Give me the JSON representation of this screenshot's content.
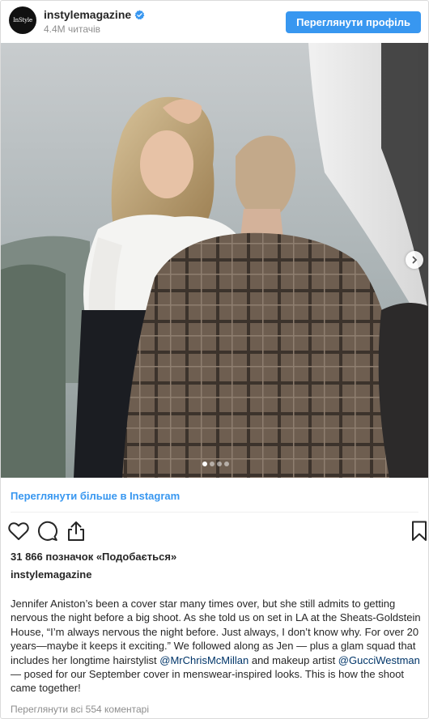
{
  "header": {
    "avatar_text": "InStyle",
    "username": "instylemagazine",
    "followers": "4.4M читачів",
    "profile_button": "Переглянути профіль",
    "verified_icon": "verified-badge-icon",
    "accent_color": "#3897f0"
  },
  "media": {
    "carousel_total": 4,
    "carousel_active": 1,
    "next_icon": "chevron-right-icon"
  },
  "view_more": "Переглянути більше в Instagram",
  "actions": {
    "like_icon": "heart-icon",
    "comment_icon": "comment-icon",
    "share_icon": "share-icon",
    "save_icon": "bookmark-icon"
  },
  "likes": "31 866 позначок «Подобається»",
  "caption": {
    "username": "instylemagazine",
    "text_1": "Jennifer Aniston’s been a cover star many times over, but she still admits to getting nervous the night before a big shoot. As she told us on set in LA at the Sheats-Goldstein House, “I’m always nervous the night before. Just always, I don’t know why. For over 20 years—maybe it keeps it exciting.” We followed along as Jen — plus a glam squad that includes her longtime hairstylist ",
    "mention_1": "@MrChrisMcMillan",
    "text_2": " and makeup artist ",
    "mention_2": "@GucciWestman",
    "text_3": " — posed for our September cover in menswear-inspired looks. This is how the shoot came together!"
  },
  "comments_link": "Переглянути всі 554 коментарі"
}
